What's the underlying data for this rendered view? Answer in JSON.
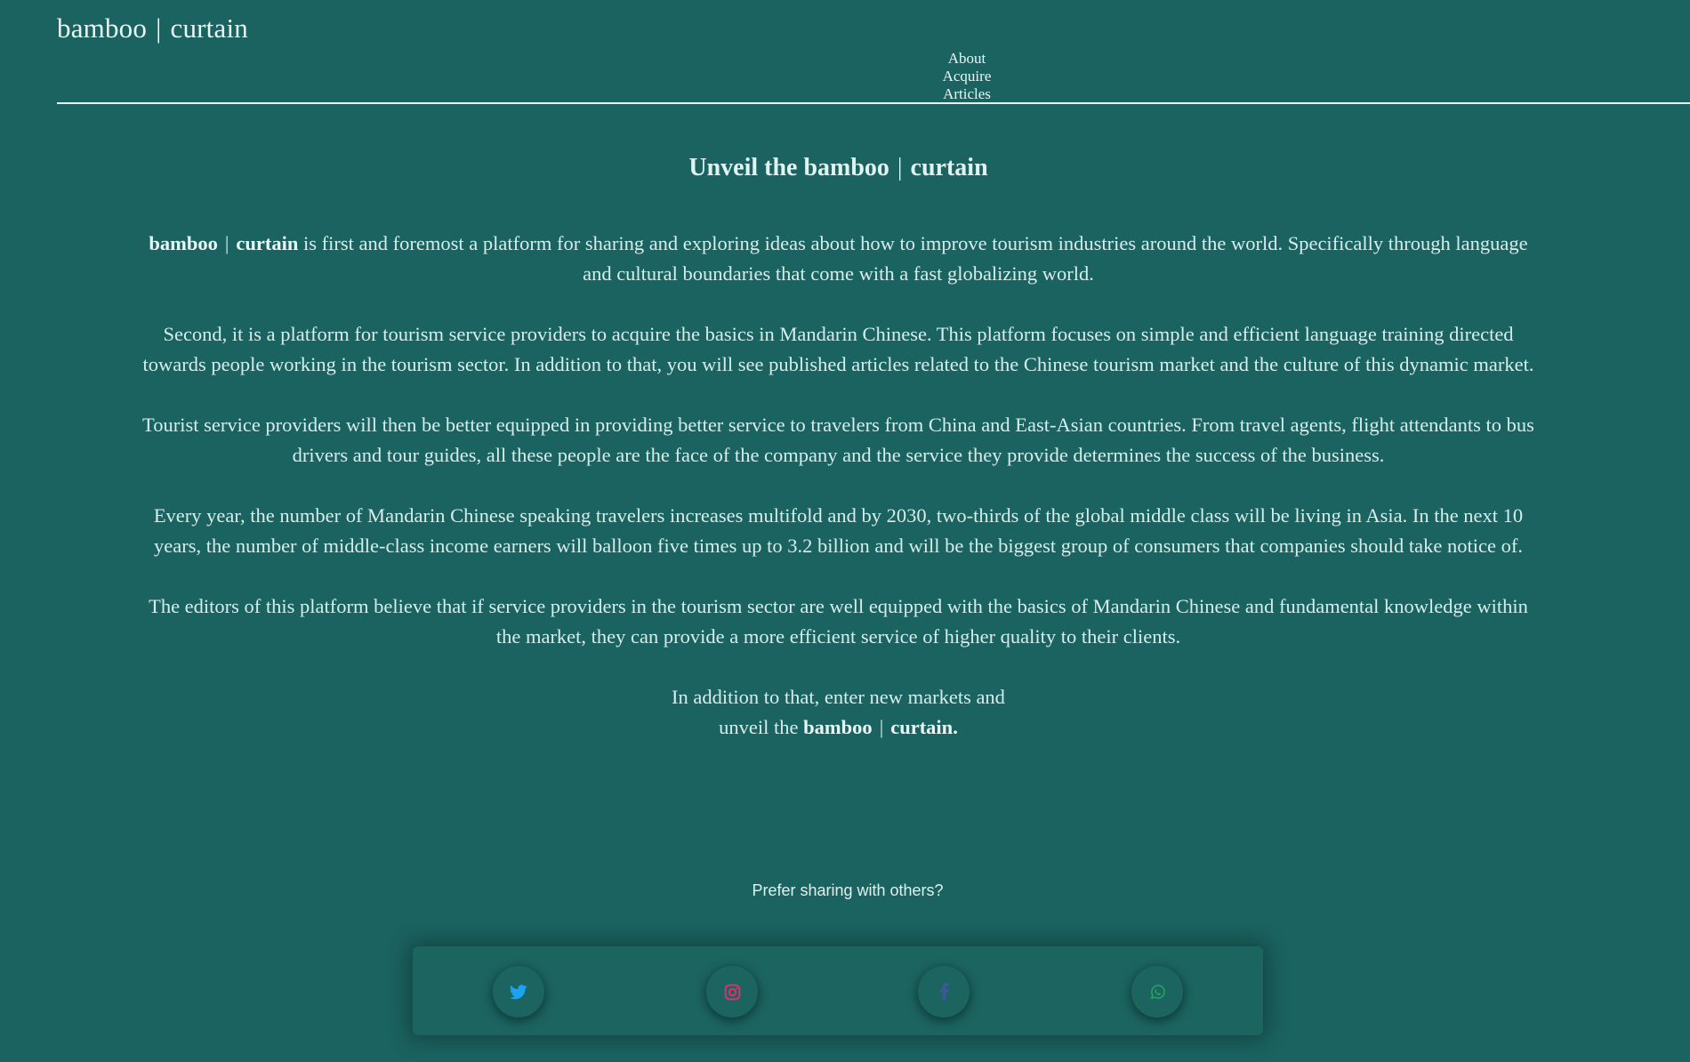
{
  "header": {
    "brand_left": "bamboo",
    "brand_sep": "|",
    "brand_right": "curtain",
    "nav": [
      {
        "label": "About"
      },
      {
        "label": "Acquire"
      },
      {
        "label": "Articles"
      }
    ]
  },
  "main": {
    "title_prefix": "Unveil the bamboo",
    "title_sep": "|",
    "title_suffix": "curtain",
    "intro_brand_left": "bamboo",
    "intro_brand_sep": "|",
    "intro_brand_right": "curtain",
    "intro_text": "is first and foremost a platform for sharing and exploring ideas about how to improve tourism industries around the world. Specifically through language and cultural boundaries that come with a fast globalizing world.",
    "paragraphs": [
      "Second, it is a platform for tourism service providers to acquire the basics in Mandarin Chinese. This platform focuses on simple and efficient language training directed towards people working in the tourism sector. In addition to that, you will see published articles related to the Chinese tourism market and the culture of this dynamic market.",
      "Tourist service providers will then be better equipped in providing better service to travelers from China and East-Asian countries. From travel agents, flight attendants to bus drivers and tour guides, all these people are the face of the company and the service they provide determines the success of the business.",
      "Every year, the number of Mandarin Chinese speaking travelers increases multifold and by 2030, two-thirds of the global middle class will be living in Asia. In the next 10 years, the number of middle-class income earners will balloon five times up to 3.2 billion and will be the biggest group of consumers that companies should take notice of.",
      "The editors of this platform believe that if service providers in the tourism sector are well equipped with the basics of Mandarin Chinese and fundamental knowledge within the market, they can provide a more efficient service of higher quality to their clients."
    ],
    "closing_line1": "In addition to that, enter new markets and",
    "closing_line2_prefix": "unveil the",
    "closing_brand_left": "bamboo",
    "closing_brand_sep": "|",
    "closing_brand_right": "curtain."
  },
  "share": {
    "title": "Prefer sharing with others?",
    "buttons": [
      {
        "icon": "twitter-icon",
        "color": "#1da1f2"
      },
      {
        "icon": "instagram-icon",
        "color": "#e1306c"
      },
      {
        "icon": "facebook-icon",
        "color": "#3b5998"
      },
      {
        "icon": "whatsapp-icon",
        "color": "#25a35a"
      }
    ]
  }
}
